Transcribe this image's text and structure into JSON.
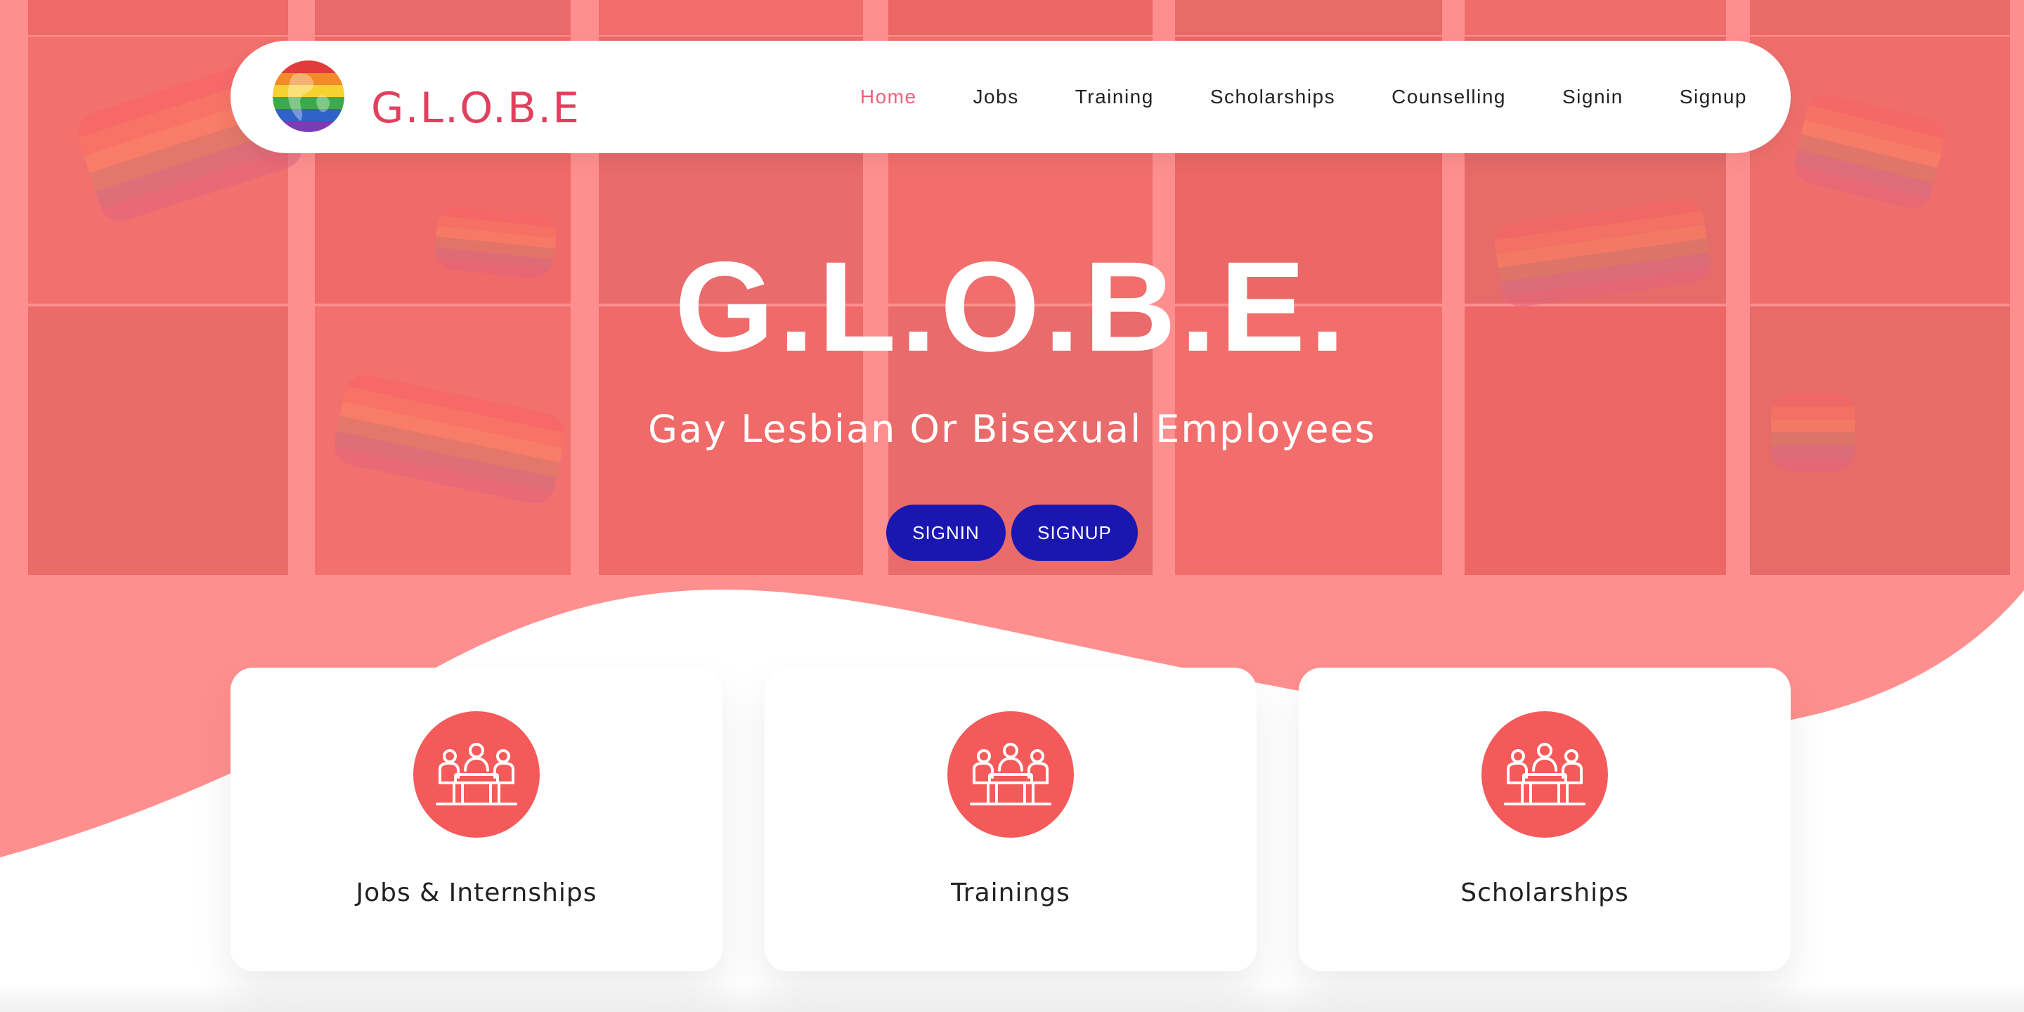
{
  "colors": {
    "tint": "#ff6f6f",
    "wave_bg": "#ffffff",
    "nav_active": "#f0607a",
    "brand": "#e0405e",
    "button": "#1a17b0",
    "card_icon_bg": "#f45a5a"
  },
  "navbar": {
    "logo_icon": "rainbow-globe-icon",
    "brand_name": "G.L.O.B.E",
    "links": [
      {
        "label": "Home",
        "active": true
      },
      {
        "label": "Jobs",
        "active": false
      },
      {
        "label": "Training",
        "active": false
      },
      {
        "label": "Scholarships",
        "active": false
      },
      {
        "label": "Counselling",
        "active": false
      },
      {
        "label": "Signin",
        "active": false
      },
      {
        "label": "Signup",
        "active": false
      }
    ]
  },
  "hero": {
    "title": "G.L.O.B.E.",
    "subtitle": "Gay Lesbian Or Bisexual Employees",
    "signin_label": "SIGNIN",
    "signup_label": "SIGNUP"
  },
  "cards": [
    {
      "title": "Jobs & Internships",
      "icon": "meeting-table-icon"
    },
    {
      "title": "Trainings",
      "icon": "meeting-table-icon"
    },
    {
      "title": "Scholarships",
      "icon": "meeting-table-icon"
    }
  ]
}
